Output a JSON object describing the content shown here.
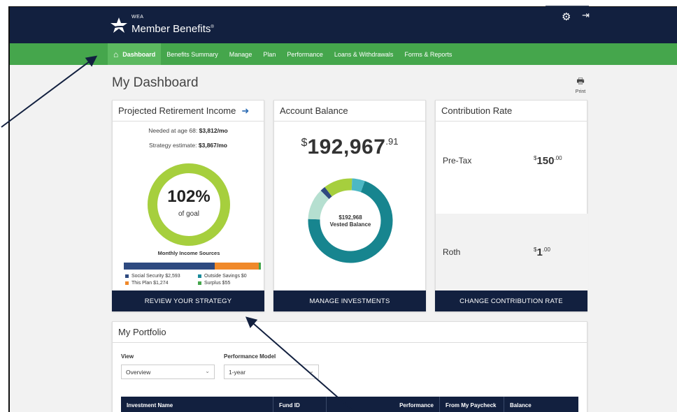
{
  "brand": {
    "small": "WEA",
    "name": "Member Benefits",
    "mark": "®"
  },
  "header_icons": {
    "settings": "gear-icon",
    "logout": "logout-icon"
  },
  "nav": [
    "Dashboard",
    "Benefits Summary",
    "Manage",
    "Plan",
    "Performance",
    "Loans & Withdrawals",
    "Forms & Reports"
  ],
  "page_title": "My Dashboard",
  "print_label": "Print",
  "income": {
    "title": "Projected Retirement Income",
    "needed_label": "Needed at age 68:",
    "needed_value": "$3,812/mo",
    "strategy_label": "Strategy estimate:",
    "strategy_value": "$3,867/mo",
    "percent": "102%",
    "goal_label": "of goal",
    "goal_fraction": 1.0,
    "sources_title": "Monthly Income Sources",
    "sources": [
      {
        "label": "Social Security $2,593",
        "value": 2593,
        "color": "#2e4a80"
      },
      {
        "label": "This Plan $1,274",
        "value": 1274,
        "color": "#f0892a"
      },
      {
        "label": "Outside Savings $0",
        "value": 0,
        "color": "#1a8b9a"
      },
      {
        "label": "Surplus $55",
        "value": 55,
        "color": "#45a64c"
      }
    ],
    "button": "REVIEW YOUR STRATEGY"
  },
  "balance": {
    "title": "Account Balance",
    "currency": "$",
    "amount": "192,967",
    "cents": ".91",
    "center_amount": "$192,968",
    "center_label": "Vested Balance",
    "segments": [
      {
        "value": 0.7,
        "color": "#17858f"
      },
      {
        "value": 0.12,
        "color": "#b5dfd0"
      },
      {
        "value": 0.02,
        "color": "#2e4a80"
      },
      {
        "value": 0.11,
        "color": "#a6cf3d"
      },
      {
        "value": 0.05,
        "color": "#4cb8c4"
      }
    ],
    "button": "MANAGE INVESTMENTS"
  },
  "contribution": {
    "title": "Contribution Rate",
    "rows": [
      {
        "label": "Pre-Tax",
        "currency": "$",
        "whole": "150",
        "cents": ".00"
      },
      {
        "label": "Roth",
        "currency": "$",
        "whole": "1",
        "cents": ".00"
      }
    ],
    "button": "CHANGE CONTRIBUTION RATE"
  },
  "portfolio": {
    "title": "My Portfolio",
    "view_label": "View",
    "view_value": "Overview",
    "model_label": "Performance Model",
    "model_value": "1-year",
    "columns": [
      "Investment Name",
      "Fund ID",
      "Performance",
      "From My Paycheck",
      "Balance"
    ]
  },
  "colors": {
    "navy": "#12203f",
    "green": "#45a64c",
    "ring": "#a6cf3d"
  }
}
